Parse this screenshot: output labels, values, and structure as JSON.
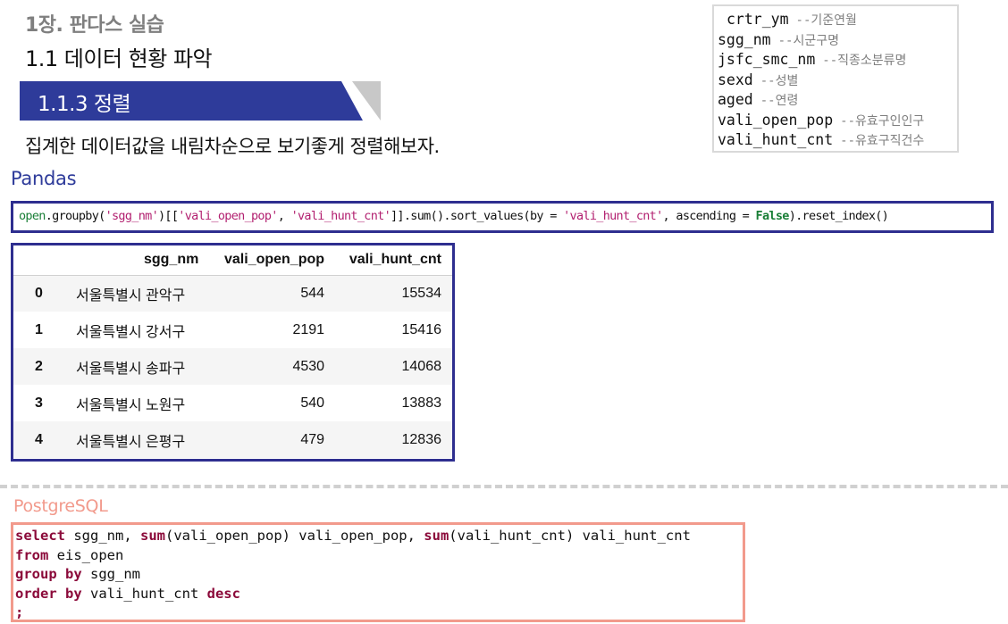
{
  "header": {
    "chapter": "1장. 판다스 실습",
    "section": "1.1 데이터 현황 파악",
    "subsection": "1.1.3 정렬",
    "description": "집계한 데이터값을 내림차순으로 보기좋게 정렬해보자."
  },
  "columns_legend": [
    {
      "name": "crtr_ym",
      "comment": "--기준연월"
    },
    {
      "name": "sgg_nm",
      "comment": "--시군구명"
    },
    {
      "name": "jsfc_smc_nm",
      "comment": "--직종소분류명"
    },
    {
      "name": "sexd",
      "comment": "--성별"
    },
    {
      "name": "aged",
      "comment": "--연령"
    },
    {
      "name": "vali_open_pop",
      "comment": "--유효구인인구"
    },
    {
      "name": "vali_hunt_cnt",
      "comment": "--유효구직건수"
    }
  ],
  "pandas": {
    "label": "Pandas",
    "code": {
      "t1": "open",
      "t2": ".groupby(",
      "t3": "'sgg_nm'",
      "t4": ")[[",
      "t5": "'vali_open_pop'",
      "t6": ", ",
      "t7": "'vali_hunt_cnt'",
      "t8": "]].sum().sort_values(by = ",
      "t9": "'vali_hunt_cnt'",
      "t10": ", ascending = ",
      "t11": "False",
      "t12": ").reset_index()"
    }
  },
  "result_table": {
    "headers": [
      "",
      "sgg_nm",
      "vali_open_pop",
      "vali_hunt_cnt"
    ],
    "rows": [
      {
        "idx": "0",
        "sgg_nm": "서울특별시 관악구",
        "vali_open_pop": "544",
        "vali_hunt_cnt": "15534"
      },
      {
        "idx": "1",
        "sgg_nm": "서울특별시 강서구",
        "vali_open_pop": "2191",
        "vali_hunt_cnt": "15416"
      },
      {
        "idx": "2",
        "sgg_nm": "서울특별시 송파구",
        "vali_open_pop": "4530",
        "vali_hunt_cnt": "14068"
      },
      {
        "idx": "3",
        "sgg_nm": "서울특별시 노원구",
        "vali_open_pop": "540",
        "vali_hunt_cnt": "13883"
      },
      {
        "idx": "4",
        "sgg_nm": "서울특별시 은평구",
        "vali_open_pop": "479",
        "vali_hunt_cnt": "12836"
      }
    ]
  },
  "postgresql": {
    "label": "PostgreSQL",
    "lines": {
      "l1_kw": "select",
      "l1_a": " sgg_nm, ",
      "l1_fn1": "sum",
      "l1_b": "(vali_open_pop) vali_open_pop, ",
      "l1_fn2": "sum",
      "l1_c": "(vali_hunt_cnt) vali_hunt_cnt",
      "l2_kw": "from",
      "l2_a": " eis_open",
      "l3_kw": "group by",
      "l3_a": " sgg_nm",
      "l4_kw": "order by",
      "l4_a": " vali_hunt_cnt ",
      "l4_kw2": "desc",
      "l5": ";"
    }
  },
  "colors": {
    "banner": "#2e3b9a",
    "pandas_border": "#2e2e8f",
    "sql_border": "#f29a8c",
    "sql_keyword": "#8b0a3a"
  }
}
